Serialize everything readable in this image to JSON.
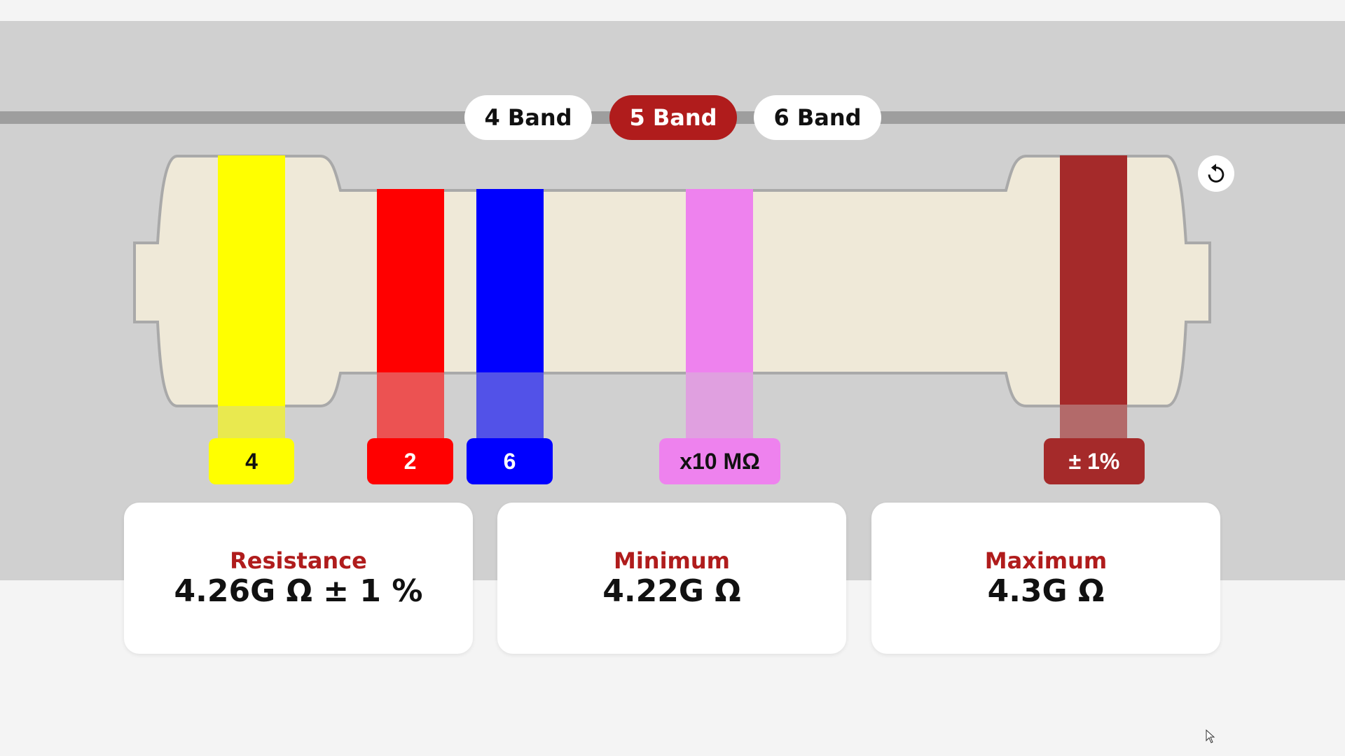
{
  "tabs": [
    {
      "label": "4 Band",
      "active": false
    },
    {
      "label": "5 Band",
      "active": true
    },
    {
      "label": "6 Band",
      "active": false
    }
  ],
  "resistor": {
    "body_color": "#efe9d8",
    "outline_color": "#a9a9a9",
    "bands": [
      {
        "label": "4",
        "color": "#ffff00",
        "chip_color": "#ffff00",
        "text_color": "#111111",
        "role": "digit"
      },
      {
        "label": "2",
        "color": "#ff0000",
        "chip_color": "#ff0000",
        "text_color": "#ffffff",
        "role": "digit"
      },
      {
        "label": "6",
        "color": "#0000ff",
        "chip_color": "#0000ff",
        "text_color": "#ffffff",
        "role": "digit"
      },
      {
        "label": "x10 MΩ",
        "color": "#ee82ee",
        "chip_color": "#ee82ee",
        "text_color": "#111111",
        "role": "multiplier"
      },
      {
        "label": "± 1%",
        "color": "#a52a2a",
        "chip_color": "#a52a2a",
        "text_color": "#ffffff",
        "role": "tolerance"
      }
    ]
  },
  "reset": {
    "icon": "reset-icon"
  },
  "results": [
    {
      "label": "Resistance",
      "value": "4.26G Ω ± 1 %"
    },
    {
      "label": "Minimum",
      "value": "4.22G Ω"
    },
    {
      "label": "Maximum",
      "value": "4.3G Ω"
    }
  ],
  "colors": {
    "accent": "#b01c1c",
    "stage": "#d0d0d0",
    "rail": "#9e9e9e"
  }
}
